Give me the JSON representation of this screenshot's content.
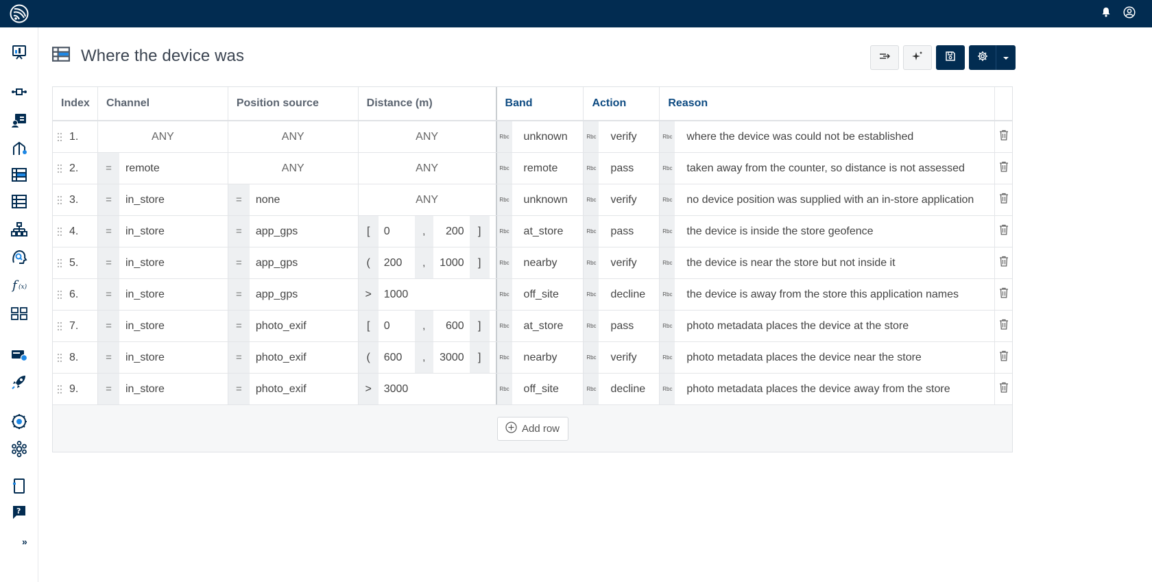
{
  "page": {
    "title": "Where the device was"
  },
  "columns": {
    "index": "Index",
    "channel": "Channel",
    "position_source": "Position source",
    "distance": "Distance (m)",
    "band": "Band",
    "action": "Action",
    "reason": "Reason"
  },
  "rows": [
    {
      "index": "1.",
      "channel": {
        "op": "",
        "value": "ANY"
      },
      "position": {
        "op": "",
        "value": "ANY"
      },
      "distance": {
        "kind": "any",
        "value": "ANY"
      },
      "band": "unknown",
      "action": "verify",
      "reason": "where the device was could not be established"
    },
    {
      "index": "2.",
      "channel": {
        "op": "=",
        "value": "remote"
      },
      "position": {
        "op": "",
        "value": "ANY"
      },
      "distance": {
        "kind": "any",
        "value": "ANY"
      },
      "band": "remote",
      "action": "pass",
      "reason": "taken away from the counter, so distance is not assessed"
    },
    {
      "index": "3.",
      "channel": {
        "op": "=",
        "value": "in_store"
      },
      "position": {
        "op": "=",
        "value": "none"
      },
      "distance": {
        "kind": "any",
        "value": "ANY"
      },
      "band": "unknown",
      "action": "verify",
      "reason": "no device position was supplied with an in-store application"
    },
    {
      "index": "4.",
      "channel": {
        "op": "=",
        "value": "in_store"
      },
      "position": {
        "op": "=",
        "value": "app_gps"
      },
      "distance": {
        "kind": "range",
        "open": "[",
        "low": "0",
        "sep": ",",
        "high": "200",
        "close": "]"
      },
      "band": "at_store",
      "action": "pass",
      "reason": "the device is inside the store geofence"
    },
    {
      "index": "5.",
      "channel": {
        "op": "=",
        "value": "in_store"
      },
      "position": {
        "op": "=",
        "value": "app_gps"
      },
      "distance": {
        "kind": "range",
        "open": "(",
        "low": "200",
        "sep": ",",
        "high": "1000",
        "close": "]"
      },
      "band": "nearby",
      "action": "verify",
      "reason": "the device is near the store but not inside it"
    },
    {
      "index": "6.",
      "channel": {
        "op": "=",
        "value": "in_store"
      },
      "position": {
        "op": "=",
        "value": "app_gps"
      },
      "distance": {
        "kind": "gt",
        "op": ">",
        "value": "1000"
      },
      "band": "off_site",
      "action": "decline",
      "reason": "the device is away from the store this application names"
    },
    {
      "index": "7.",
      "channel": {
        "op": "=",
        "value": "in_store"
      },
      "position": {
        "op": "=",
        "value": "photo_exif"
      },
      "distance": {
        "kind": "range",
        "open": "[",
        "low": "0",
        "sep": ",",
        "high": "600",
        "close": "]"
      },
      "band": "at_store",
      "action": "pass",
      "reason": "photo metadata places the device at the store"
    },
    {
      "index": "8.",
      "channel": {
        "op": "=",
        "value": "in_store"
      },
      "position": {
        "op": "=",
        "value": "photo_exif"
      },
      "distance": {
        "kind": "range",
        "open": "(",
        "low": "600",
        "sep": ",",
        "high": "3000",
        "close": "]"
      },
      "band": "nearby",
      "action": "verify",
      "reason": "photo metadata places the device near the store"
    },
    {
      "index": "9.",
      "channel": {
        "op": "=",
        "value": "in_store"
      },
      "position": {
        "op": "=",
        "value": "photo_exif"
      },
      "distance": {
        "kind": "gt",
        "op": ">",
        "value": "3000"
      },
      "band": "off_site",
      "action": "decline",
      "reason": "photo metadata places the device away from the store"
    }
  ],
  "string_type_marker": "Rbc",
  "footer": {
    "add_row_label": "Add row"
  },
  "sidebar": {
    "expand_label": "»"
  },
  "icons": {
    "logo": "company-logo-icon",
    "notifications": "bell-icon",
    "account": "user-circle-icon",
    "row_delete": "trash-icon",
    "row_drag": "drag-handle-icon",
    "add": "plus-circle-icon",
    "toolbar": [
      "flow-direction-icon",
      "sparkle-icon",
      "save-icon",
      "gear-icon",
      "caret-down-icon"
    ]
  },
  "colors": {
    "topbar": "#022c51",
    "primary_button": "#022c51",
    "output_header": "#0e4b82",
    "condition_cell": "#eef0f2"
  }
}
